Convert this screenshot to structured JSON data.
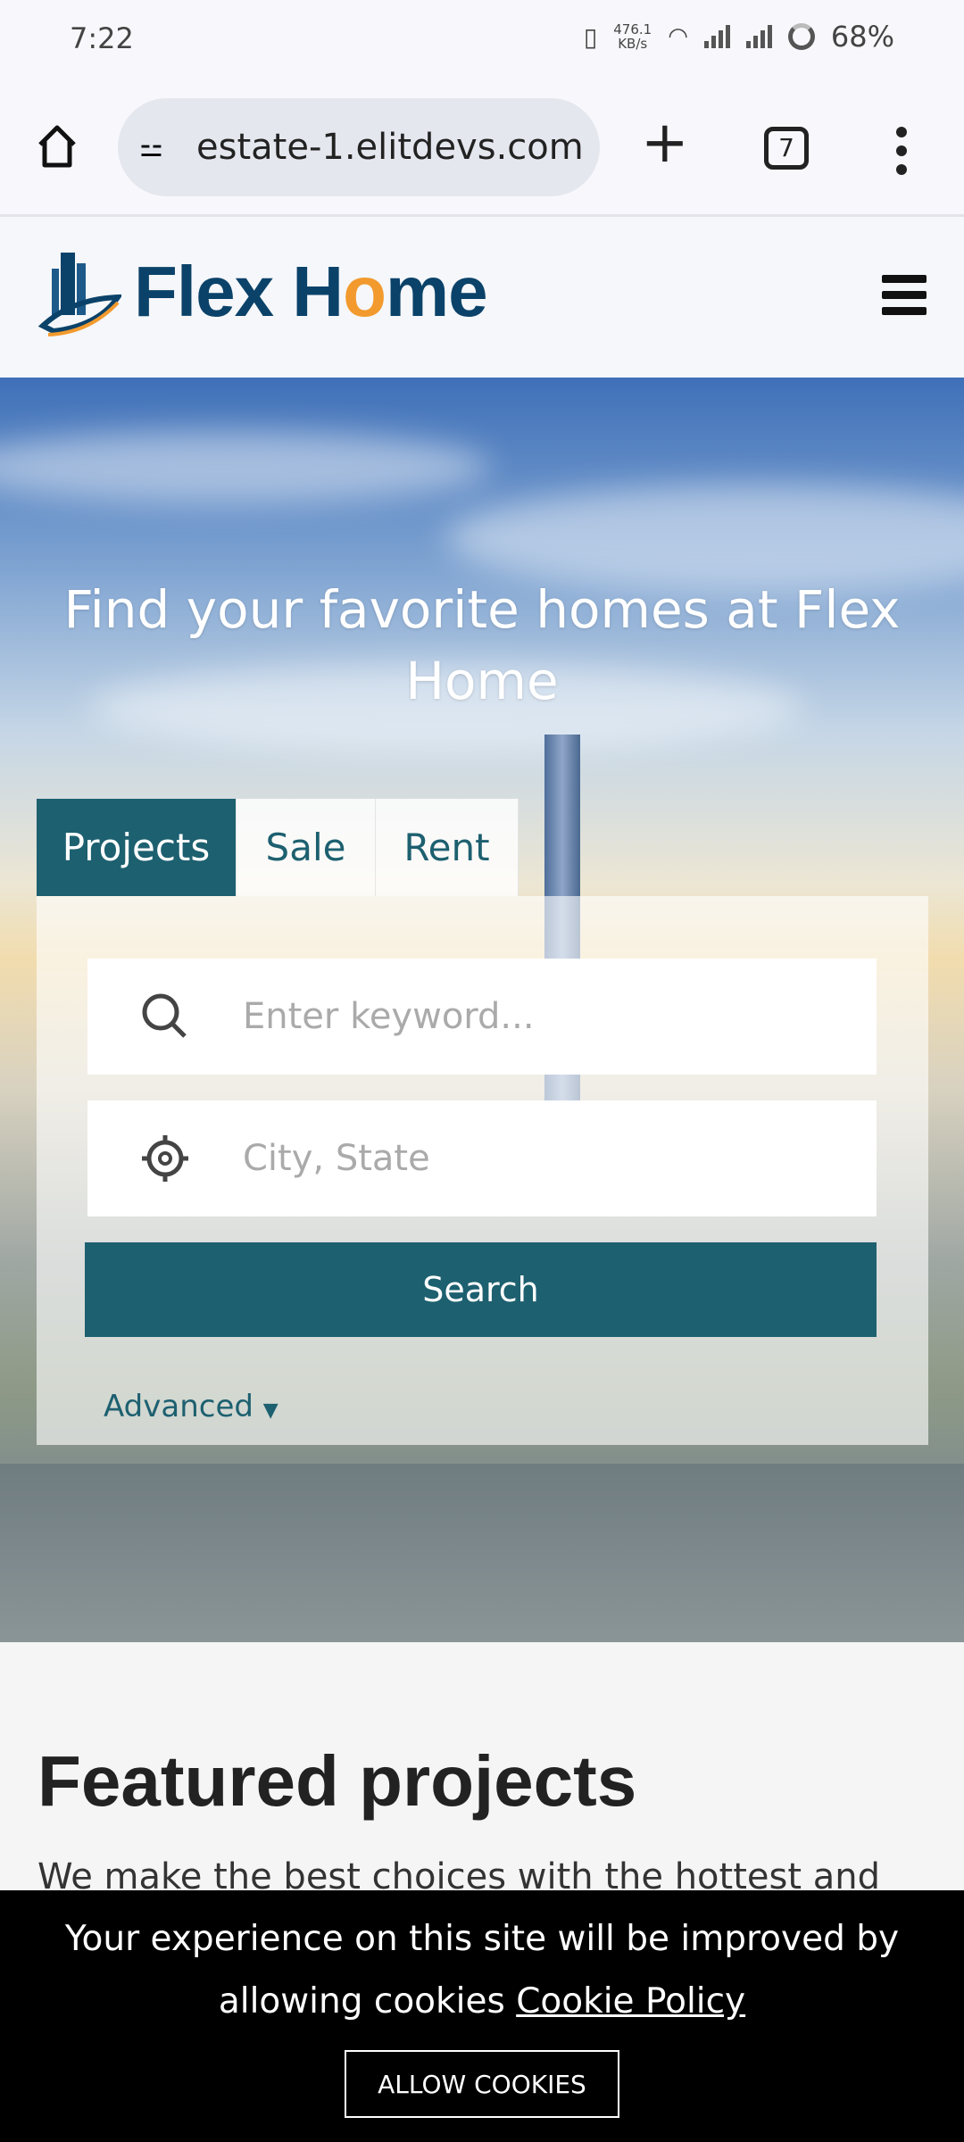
{
  "status_bar": {
    "time": "7:22",
    "net_speed": "476.1",
    "net_unit": "KB/s",
    "battery": "68%"
  },
  "browser": {
    "url": "estate-1.elitdevs.com",
    "tab_count": "7"
  },
  "header": {
    "logo_text_1": "Flex H",
    "logo_text_o": "o",
    "logo_text_2": "me"
  },
  "hero": {
    "title": "Find your favorite homes at Flex Home",
    "tabs": [
      {
        "label": "Projects",
        "active": true
      },
      {
        "label": "Sale"
      },
      {
        "label": "Rent"
      }
    ],
    "keyword_placeholder": "Enter keyword...",
    "location_placeholder": "City, State",
    "search_label": "Search",
    "advanced_label": "Advanced"
  },
  "featured": {
    "title": "Featured projects",
    "subtitle": "We make the best choices with the hottest and"
  },
  "cookie": {
    "text": "Your experience on this site will be improved by allowing cookies",
    "link": "Cookie Policy",
    "button": "ALLOW COOKIES"
  },
  "colors": {
    "accent": "#1d6070",
    "brand": "#0b4269",
    "brand_orange": "#f29a2e"
  }
}
